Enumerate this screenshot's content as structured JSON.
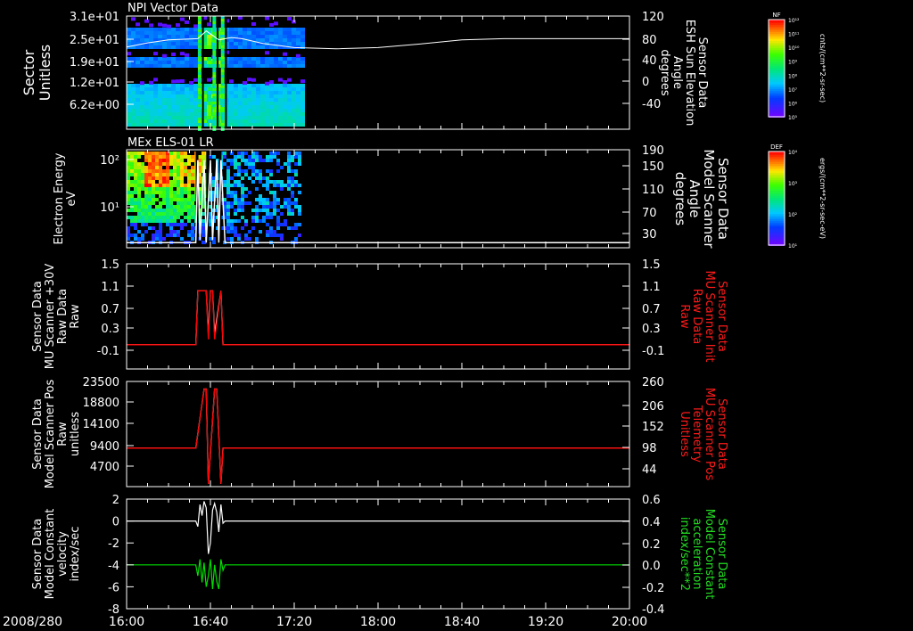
{
  "date_label": "2008/280",
  "time_axis": {
    "start": "16:00",
    "end": "20:00",
    "ticks": [
      "16:00",
      "16:40",
      "17:20",
      "18:00",
      "18:40",
      "19:20",
      "20:00"
    ]
  },
  "colors": {
    "background": "#000000",
    "axis": "#ffffff",
    "red_trace": "#ff0000",
    "green_trace": "#00e000",
    "white_trace": "#ffffff"
  },
  "chart_data": [
    {
      "type": "heatmap",
      "title": "NPI Vector Data",
      "ylabel": [
        "Sector",
        "Unitless"
      ],
      "y_ticks": [
        "3.1e+01",
        "2.5e+01",
        "1.9e+01",
        "1.2e+01",
        "6.2e+00"
      ],
      "y2label": [
        "Sensor Data",
        "ESH Sun Elevation",
        "Angle",
        "degrees"
      ],
      "y2_ticks": [
        "120",
        "80",
        "40",
        "0",
        "-40"
      ],
      "y2lim": [
        -70,
        120
      ],
      "data_extent": [
        "16:00",
        "17:23"
      ],
      "overlay_line": {
        "color": "#ffffff",
        "x": [
          "16:00",
          "16:10",
          "16:20",
          "16:34",
          "16:38",
          "16:44",
          "16:50",
          "16:55",
          "17:05",
          "17:20",
          "17:40",
          "18:00",
          "18:20",
          "18:40",
          "19:00",
          "19:20",
          "19:40",
          "20:00"
        ],
        "y": [
          68,
          75,
          80,
          82,
          95,
          80,
          84,
          82,
          74,
          67,
          65,
          67,
          73,
          80,
          82,
          82,
          82,
          82
        ]
      }
    },
    {
      "type": "heatmap",
      "title": "MEx ELS-01 LR",
      "ylabel": [
        "Electron Energy",
        "eV"
      ],
      "y_ticks": [
        "10²",
        "10¹"
      ],
      "y2label": [
        "Sensor Data",
        "Model Scanner",
        "Angle",
        "degrees"
      ],
      "y2_ticks": [
        "190",
        "150",
        "110",
        "70",
        "30"
      ],
      "y2lim": [
        0,
        190
      ],
      "data_extent": [
        "16:00",
        "17:23"
      ],
      "overlay_line": {
        "color": "#ffffff",
        "x": [
          "16:00",
          "16:33",
          "16:34",
          "16:35",
          "16:37",
          "16:38",
          "16:40",
          "16:41",
          "16:43",
          "16:44",
          "16:45",
          "16:47",
          "16:48",
          "20:00"
        ],
        "y": [
          10,
          10,
          170,
          15,
          170,
          10,
          170,
          15,
          170,
          10,
          170,
          10,
          10,
          10
        ]
      }
    },
    {
      "type": "line",
      "ylabel": [
        "Sensor Data",
        "MU Scanner +30V",
        "Raw Data",
        "Raw"
      ],
      "y_ticks": [
        "1.5",
        "1.1",
        "0.7",
        "0.3",
        "-0.1"
      ],
      "ylim": [
        -0.45,
        1.5
      ],
      "y2label": [
        "Sensor Data",
        "MU Scanner Init",
        "Raw Data",
        "Raw"
      ],
      "y2_ticks": [
        "1.5",
        "1.1",
        "0.7",
        "0.3",
        "-0.1"
      ],
      "series": [
        {
          "color": "#ffffff",
          "axis": "left",
          "x": [
            "16:00",
            "16:33",
            "16:34",
            "16:38",
            "16:39",
            "16:40",
            "16:41",
            "16:42",
            "16:45",
            "16:46",
            "20:00"
          ],
          "y": [
            0,
            0,
            1,
            1,
            0.2,
            1,
            1,
            0.2,
            1,
            0,
            0
          ]
        },
        {
          "color": "#ff0000",
          "axis": "right",
          "x": [
            "16:00",
            "16:33",
            "16:34",
            "16:38",
            "16:39",
            "16:40",
            "16:41",
            "16:42",
            "16:45",
            "16:46",
            "20:00"
          ],
          "y": [
            0,
            0,
            1,
            1,
            0.1,
            1,
            1,
            0.1,
            1,
            0,
            0
          ]
        }
      ]
    },
    {
      "type": "line",
      "ylabel": [
        "Sensor Data",
        "Model Scanner Pos",
        "Raw",
        "unitless"
      ],
      "y_ticks": [
        "23500",
        "18800",
        "14100",
        "9400",
        "4700"
      ],
      "ylim": [
        0,
        23500
      ],
      "y2label": [
        "Sensor Data",
        "MU Scanner Pos",
        "Telemetry",
        "Unitless"
      ],
      "y2_ticks": [
        "260",
        "206",
        "152",
        "98",
        "44"
      ],
      "series": [
        {
          "color": "#ffffff",
          "axis": "left",
          "x": [
            "16:00",
            "16:33",
            "16:37",
            "16:38",
            "16:39",
            "16:42",
            "16:43",
            "16:45",
            "16:46",
            "20:00"
          ],
          "y": [
            8600,
            8600,
            21800,
            21800,
            600,
            21800,
            21800,
            600,
            8600,
            8600
          ]
        },
        {
          "color": "#ff0000",
          "axis": "right",
          "x": [
            "16:00",
            "16:33",
            "16:37",
            "16:38",
            "16:39",
            "16:42",
            "16:43",
            "16:45",
            "16:46",
            "20:00"
          ],
          "y": [
            8600,
            8600,
            21800,
            21800,
            600,
            21800,
            21800,
            600,
            8600,
            8600
          ]
        }
      ]
    },
    {
      "type": "line",
      "ylabel": [
        "Sensor Data",
        "Model Constant",
        "velocity",
        "index/sec"
      ],
      "y_ticks": [
        "2",
        "0",
        "-2",
        "-4",
        "-6",
        "-8"
      ],
      "ylim": [
        -8,
        2
      ],
      "y2label": [
        "Sensor Data",
        "Model Constant",
        "acceleration",
        "index/sec**2"
      ],
      "y2_ticks": [
        "0.6",
        "0.4",
        "0.2",
        "0.0",
        "-0.2",
        "-0.4"
      ],
      "y2lim": [
        -0.4,
        0.6
      ],
      "series": [
        {
          "color": "#ffffff",
          "axis": "left",
          "x": [
            "16:00",
            "16:33",
            "16:34",
            "16:35",
            "16:36",
            "16:37",
            "16:38",
            "16:39",
            "16:40",
            "16:41",
            "16:42",
            "16:43",
            "16:44",
            "16:45",
            "16:46",
            "16:47",
            "20:00"
          ],
          "y": [
            0,
            0,
            -0.5,
            1.5,
            0.5,
            1.8,
            1.2,
            -3,
            -2,
            1,
            1.6,
            0.8,
            -1,
            1.5,
            -0.2,
            0,
            0
          ]
        },
        {
          "color": "#00e000",
          "axis": "right",
          "x": [
            "16:00",
            "16:33",
            "16:34",
            "16:35",
            "16:36",
            "16:37",
            "16:38",
            "16:39",
            "16:40",
            "16:41",
            "16:42",
            "16:43",
            "16:44",
            "16:45",
            "16:46",
            "16:47",
            "20:00"
          ],
          "y": [
            0,
            0,
            -0.1,
            0.05,
            -0.16,
            0.02,
            -0.2,
            -0.1,
            0.05,
            -0.22,
            0,
            -0.15,
            -0.22,
            0.05,
            -0.05,
            0,
            0
          ]
        }
      ]
    }
  ],
  "colorbars": [
    {
      "label": "NF",
      "units": "cnts/(cm**2-sr-sec)",
      "ticks": [
        "10¹²",
        "10¹¹",
        "10¹⁰",
        "10⁹",
        "10⁸",
        "10⁷",
        "10⁶",
        "10⁵"
      ]
    },
    {
      "label": "DEF",
      "units": "ergs/(cm**2-sr-sec-eV)",
      "ticks": [
        "10⁴",
        "10³",
        "10²",
        "10¹"
      ]
    }
  ]
}
